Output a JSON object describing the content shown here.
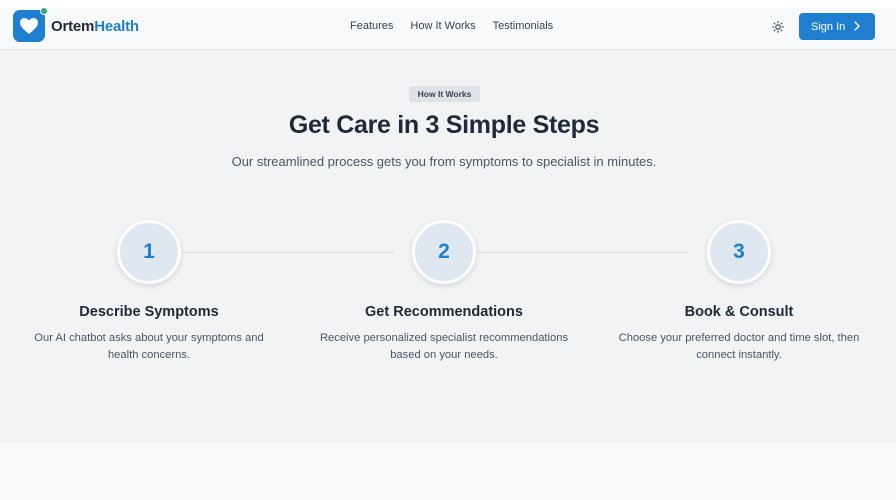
{
  "brand": {
    "name_part1": "Ortem",
    "name_part2": "Health",
    "accent": "#1e7fd0"
  },
  "nav": {
    "links": [
      "Features",
      "How It Works",
      "Testimonials"
    ],
    "theme_icon": "sun-icon",
    "signin_label": "Sign In"
  },
  "hero": {
    "badge": "How It Works",
    "title": "Get Care in 3 Simple Steps",
    "subtitle": "Our streamlined process gets you from symptoms to specialist in minutes."
  },
  "steps": [
    {
      "number": "1",
      "title": "Describe Symptoms",
      "desc_line1": "Our AI chatbot asks about your symptoms and",
      "desc_line2": "health concerns."
    },
    {
      "number": "2",
      "title": "Get Recommendations",
      "desc_line1": "Receive personalized specialist recommendations",
      "desc_line2": "based on your needs."
    },
    {
      "number": "3",
      "title": "Book & Consult",
      "desc_line1": "Choose your preferred doctor and time slot, then",
      "desc_line2": "connect instantly."
    }
  ]
}
